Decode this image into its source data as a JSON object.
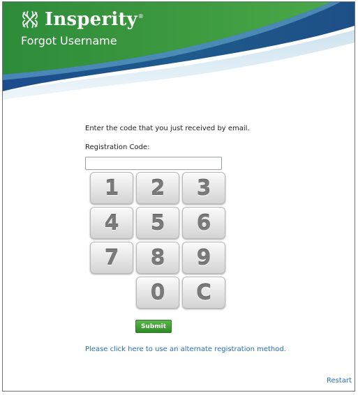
{
  "brand": {
    "logo_text": "Insperity",
    "trademark": "®",
    "logo_icon": "insperity-leaf-logo"
  },
  "header": {
    "title": "Forgot Username"
  },
  "form": {
    "instruction": "Enter the code that you just received by email.",
    "code_label": "Registration Code:",
    "code_value": "",
    "code_placeholder": ""
  },
  "keypad": {
    "keys": [
      "1",
      "2",
      "3",
      "4",
      "5",
      "6",
      "7",
      "8",
      "9",
      "0",
      "C"
    ]
  },
  "actions": {
    "submit_label": "Submit",
    "alternate_link": "Please click here to use an alternate registration method.",
    "restart_link": "Restart"
  },
  "colors": {
    "banner_green": "#2e8b3a",
    "banner_blue": "#1e4f8f",
    "submit_green": "#3a9a2e",
    "link_blue": "#2a6ebb"
  }
}
